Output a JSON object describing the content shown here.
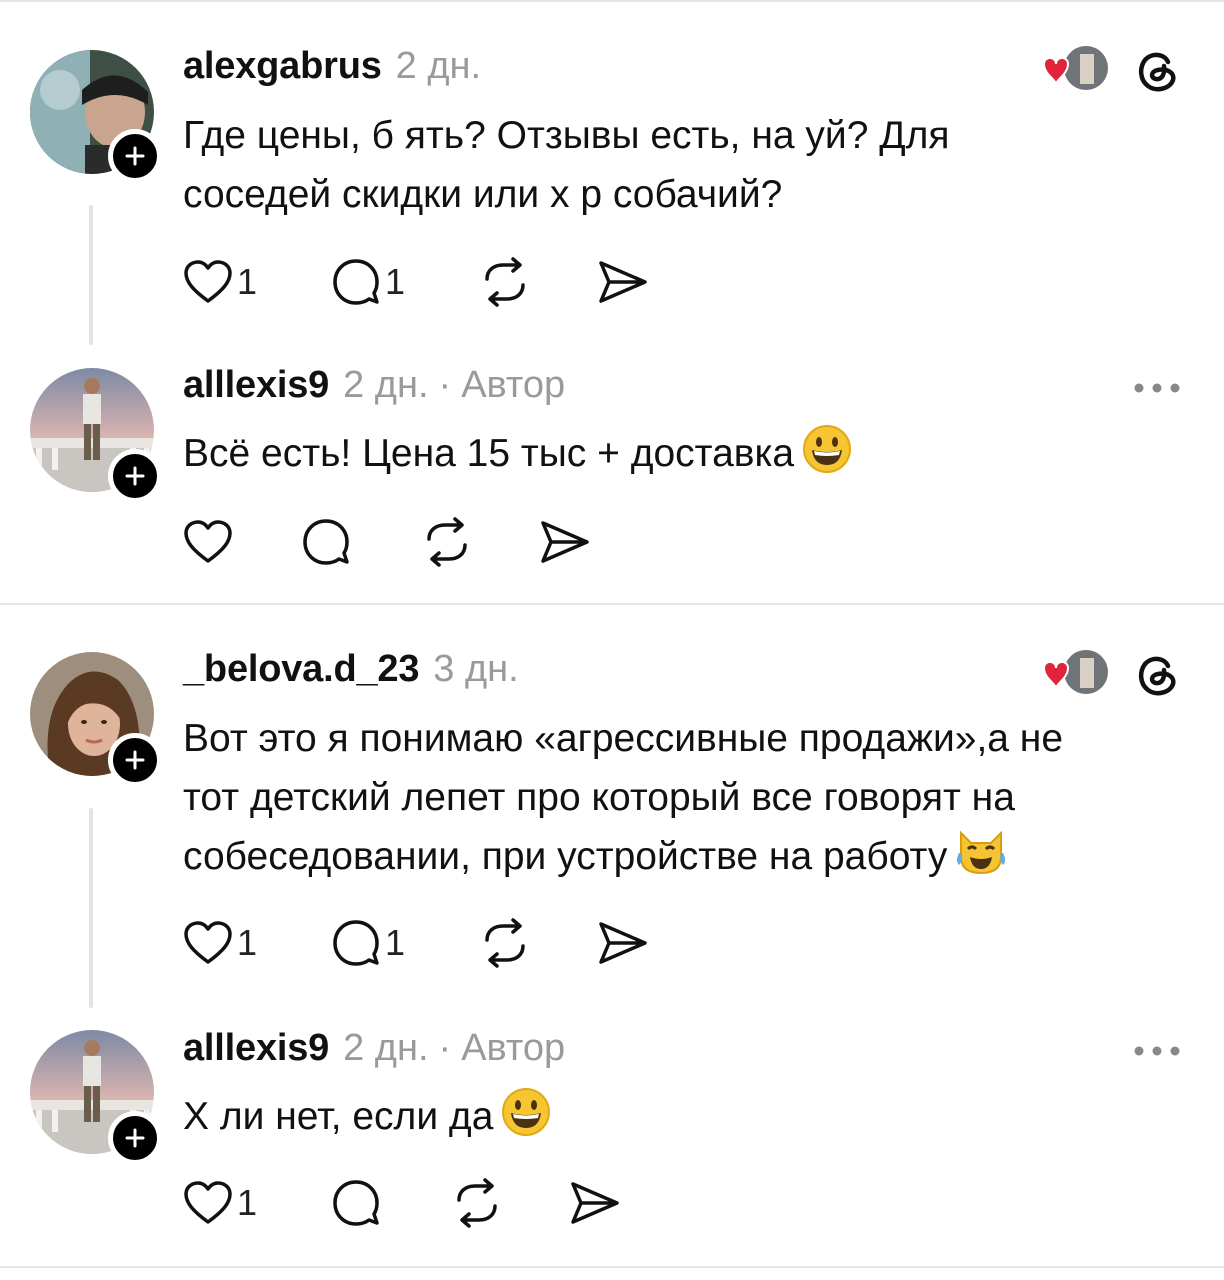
{
  "threads": [
    {
      "username": "alexgabrus",
      "time": "2 дн.",
      "text_line1": "Где цены, б  ять? Отзывы есть, на  уй? Для",
      "text_line2": "соседей скидки или х  р собачий?",
      "likes": "1",
      "replies": "1",
      "reply": {
        "username": "alllexis9",
        "time": "2 дн.",
        "separator": "·",
        "author_badge": "Автор",
        "text": "Всё есть! Цена 15 тыс + доставка",
        "emoji": "grinning-face-emoji"
      }
    },
    {
      "username": "_belova.d_23",
      "time": "3 дн.",
      "text_line1": "Вот это я понимаю «агрессивные продажи»,а не",
      "text_line2": "тот детский лепет про который все говорят на",
      "text_line3": "собеседовании, при устройстве на работу",
      "emoji": "cat-tears-of-joy-emoji",
      "likes": "1",
      "replies": "1",
      "reply": {
        "username": "alllexis9",
        "time": "2 дн.",
        "separator": "·",
        "author_badge": "Автор",
        "text": "Х  ли нет, если да",
        "emoji": "grinning-face-emoji",
        "likes": "1"
      }
    }
  ],
  "colors": {
    "text": "#111111",
    "meta": "#9a9a9a",
    "heart": "#e0243a",
    "divider": "#e6e6e6"
  }
}
